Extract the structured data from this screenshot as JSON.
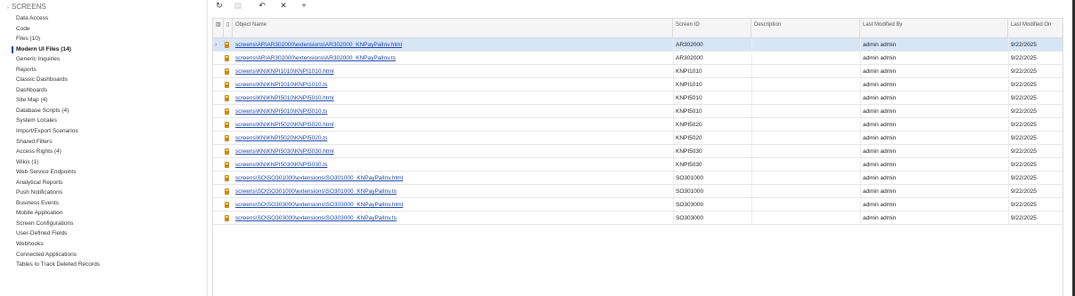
{
  "sidebar": {
    "root_label": "SCREENS",
    "items": [
      {
        "label": "Data Access",
        "active": false
      },
      {
        "label": "Code",
        "active": false
      },
      {
        "label": "Files (10)",
        "active": false
      },
      {
        "label": "Modern UI Files (14)",
        "active": true
      },
      {
        "label": "Generic Inquiries",
        "active": false
      },
      {
        "label": "Reports",
        "active": false
      },
      {
        "label": "Classic Dashboards",
        "active": false
      },
      {
        "label": "Dashboards",
        "active": false
      },
      {
        "label": "Site Map (4)",
        "active": false
      },
      {
        "label": "Database Scripts (4)",
        "active": false
      },
      {
        "label": "System Locales",
        "active": false
      },
      {
        "label": "Import/Export Scenarios",
        "active": false
      },
      {
        "label": "Shared Filters",
        "active": false
      },
      {
        "label": "Access Rights (4)",
        "active": false
      },
      {
        "label": "Wikis (1)",
        "active": false
      },
      {
        "label": "Web Service Endpoints",
        "active": false
      },
      {
        "label": "Analytical Reports",
        "active": false
      },
      {
        "label": "Push Notifications",
        "active": false
      },
      {
        "label": "Business Events",
        "active": false
      },
      {
        "label": "Mobile Application",
        "active": false
      },
      {
        "label": "Screen Configurations",
        "active": false
      },
      {
        "label": "User-Defined Fields",
        "active": false
      },
      {
        "label": "Webhooks",
        "active": false
      },
      {
        "label": "Connected Applications",
        "active": false
      },
      {
        "label": "Tables to Track Deleted Records",
        "active": false
      }
    ]
  },
  "toolbar": {
    "refresh_icon": "↻",
    "save_icon": "▤",
    "undo_icon": "↶",
    "delete_icon": "✕",
    "add_icon": "+"
  },
  "grid": {
    "headers": {
      "object_name": "Object Name",
      "screen_id": "Screen ID",
      "description": "Description",
      "last_modified_by": "Last Modified By",
      "last_modified_on": "Last Modified On"
    },
    "rows": [
      {
        "object_name": "screens\\AR\\AR302000\\extensions\\AR302000_KNPayPalInv.html",
        "screen_id": "AR302000",
        "description": "",
        "modified_by": "admin admin",
        "modified_on": "9/22/2025",
        "selected": true
      },
      {
        "object_name": "screens\\AR\\AR302000\\extensions\\AR302000_KNPayPalInv.ts",
        "screen_id": "AR302000",
        "description": "",
        "modified_by": "admin admin",
        "modified_on": "9/22/2025",
        "selected": false
      },
      {
        "object_name": "screens\\KN\\KNPI1010\\KNPI1010.html",
        "screen_id": "KNPI1010",
        "description": "",
        "modified_by": "admin admin",
        "modified_on": "9/22/2025",
        "selected": false
      },
      {
        "object_name": "screens\\KN\\KNPI1010\\KNPI1010.ts",
        "screen_id": "KNPI1010",
        "description": "",
        "modified_by": "admin admin",
        "modified_on": "9/22/2025",
        "selected": false
      },
      {
        "object_name": "screens\\KN\\KNPI5010\\KNPI5010.html",
        "screen_id": "KNPI5010",
        "description": "",
        "modified_by": "admin admin",
        "modified_on": "9/22/2025",
        "selected": false
      },
      {
        "object_name": "screens\\KN\\KNPI5010\\KNPI5010.ts",
        "screen_id": "KNPI5010",
        "description": "",
        "modified_by": "admin admin",
        "modified_on": "9/22/2025",
        "selected": false
      },
      {
        "object_name": "screens\\KN\\KNPI5020\\KNPI5020.html",
        "screen_id": "KNPI5020",
        "description": "",
        "modified_by": "admin admin",
        "modified_on": "9/22/2025",
        "selected": false
      },
      {
        "object_name": "screens\\KN\\KNPI5020\\KNPI5020.ts",
        "screen_id": "KNPI5020",
        "description": "",
        "modified_by": "admin admin",
        "modified_on": "9/22/2025",
        "selected": false
      },
      {
        "object_name": "screens\\KN\\KNPI5030\\KNPI5030.html",
        "screen_id": "KNPI5030",
        "description": "",
        "modified_by": "admin admin",
        "modified_on": "9/22/2025",
        "selected": false
      },
      {
        "object_name": "screens\\KN\\KNPI5030\\KNPI5030.ts",
        "screen_id": "KNPI5030",
        "description": "",
        "modified_by": "admin admin",
        "modified_on": "9/22/2025",
        "selected": false
      },
      {
        "object_name": "screens\\SO\\SO301000\\extensions\\SO301000_KNPayPalInv.html",
        "screen_id": "SO301000",
        "description": "",
        "modified_by": "admin admin",
        "modified_on": "9/22/2025",
        "selected": false
      },
      {
        "object_name": "screens\\SO\\SO301000\\extensions\\SO301000_KNPayPalInv.ts",
        "screen_id": "SO301000",
        "description": "",
        "modified_by": "admin admin",
        "modified_on": "9/22/2025",
        "selected": false
      },
      {
        "object_name": "screens\\SO\\SO303000\\extensions\\SO303000_KNPayPalInv.html",
        "screen_id": "SO303000",
        "description": "",
        "modified_by": "admin admin",
        "modified_on": "9/22/2025",
        "selected": false
      },
      {
        "object_name": "screens\\SO\\SO303000\\extensions\\SO303000_KNPayPalInv.ts",
        "screen_id": "SO303000",
        "description": "",
        "modified_by": "admin admin",
        "modified_on": "9/22/2025",
        "selected": false
      }
    ]
  },
  "colors": {
    "accent": "#1e4a9e",
    "link": "#1a45a8",
    "selected_row": "#d7e6f7",
    "file_icon": "#c48a1f"
  }
}
